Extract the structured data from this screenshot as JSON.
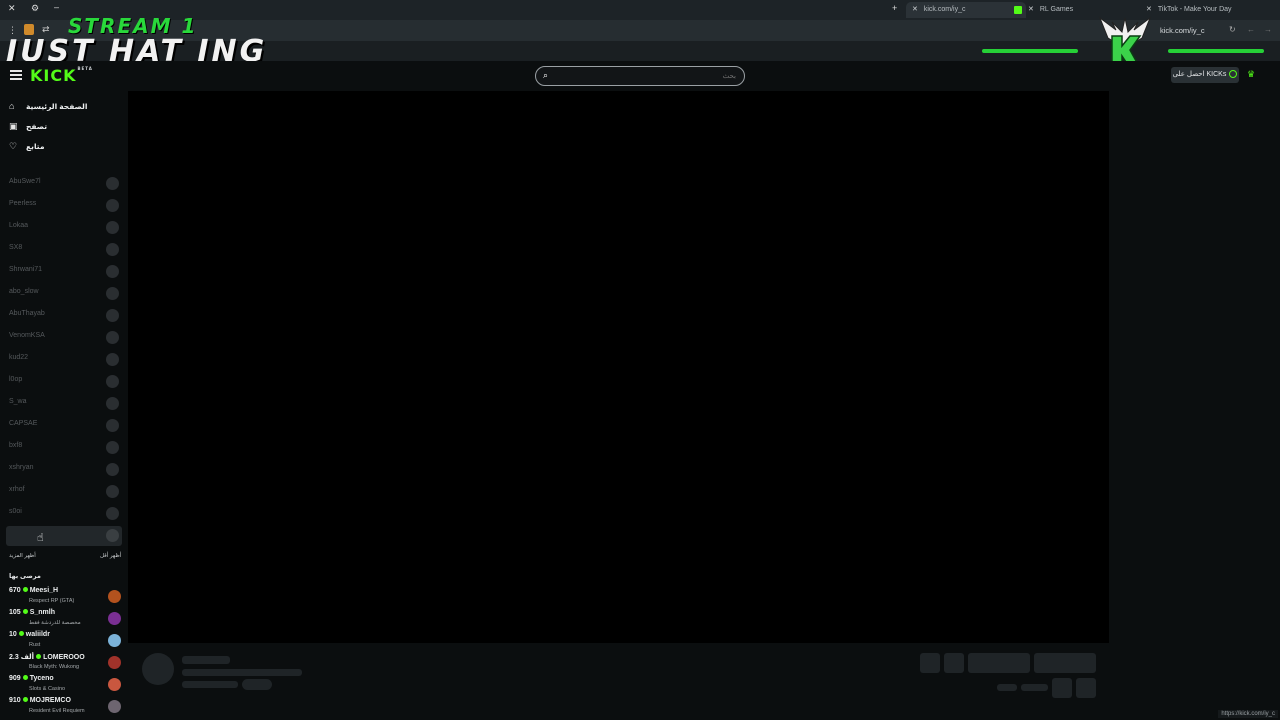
{
  "overlay": {
    "stream_label": "STREAM 1",
    "title": "JUST HAT ING"
  },
  "browser": {
    "tabs": [
      {
        "label": "kick.com/iy_c",
        "active": true
      },
      {
        "label": "RL Games",
        "active": false
      },
      {
        "label": "TikTok - Make Your Day",
        "active": false
      }
    ],
    "address": "kick.com/iy_c",
    "status_url": "https://kick.com/iy_c"
  },
  "header": {
    "logo": "KICK",
    "logo_badge": "BETA",
    "search_placeholder": "بحث",
    "kicks_button": "احصل على KICKs"
  },
  "nav": [
    {
      "label": "الصفحة الرئيسية",
      "icon": "home-icon"
    },
    {
      "label": "تصفح",
      "icon": "browse-icon"
    },
    {
      "label": "متابع",
      "icon": "heart-icon"
    }
  ],
  "following": [
    "AbuSwe7l",
    "Peerless",
    "Lokaa",
    "SX8",
    "Shrwani71",
    "abo_slow",
    "AbuThayab",
    "VenomKSA",
    "kud22",
    "l0op",
    "S_wa",
    "CAPSAE",
    "bxf8",
    "xshryan",
    "xrhof",
    "s0oi"
  ],
  "sidebar_links": {
    "show_more": "أظهر المزيد",
    "show_less": "أظهر أقل"
  },
  "recommended": {
    "title": "مرصى بها",
    "items": [
      {
        "viewers": "670",
        "name": "Meesi_H",
        "category": "Respect RP (GTA)",
        "avatar_color": "#b3521e"
      },
      {
        "viewers": "105",
        "name": "S_nmlh",
        "category": "مخصصة للدردشة فقط",
        "avatar_color": "#7a2f93"
      },
      {
        "viewers": "10",
        "name": "waliildr",
        "category": "Rust",
        "avatar_color": "#7bb2d8"
      },
      {
        "viewers": "2.3 ألف",
        "name": "LOMEROOO",
        "category": "Black Myth: Wukong",
        "avatar_color": "#a0322a"
      },
      {
        "viewers": "909",
        "name": "Tyceno",
        "category": "Slots & Casino",
        "avatar_color": "#c9573f"
      },
      {
        "viewers": "910",
        "name": "MOJREMCO",
        "category": "Resident Evil Requiem",
        "avatar_color": "#6d6570"
      }
    ]
  }
}
